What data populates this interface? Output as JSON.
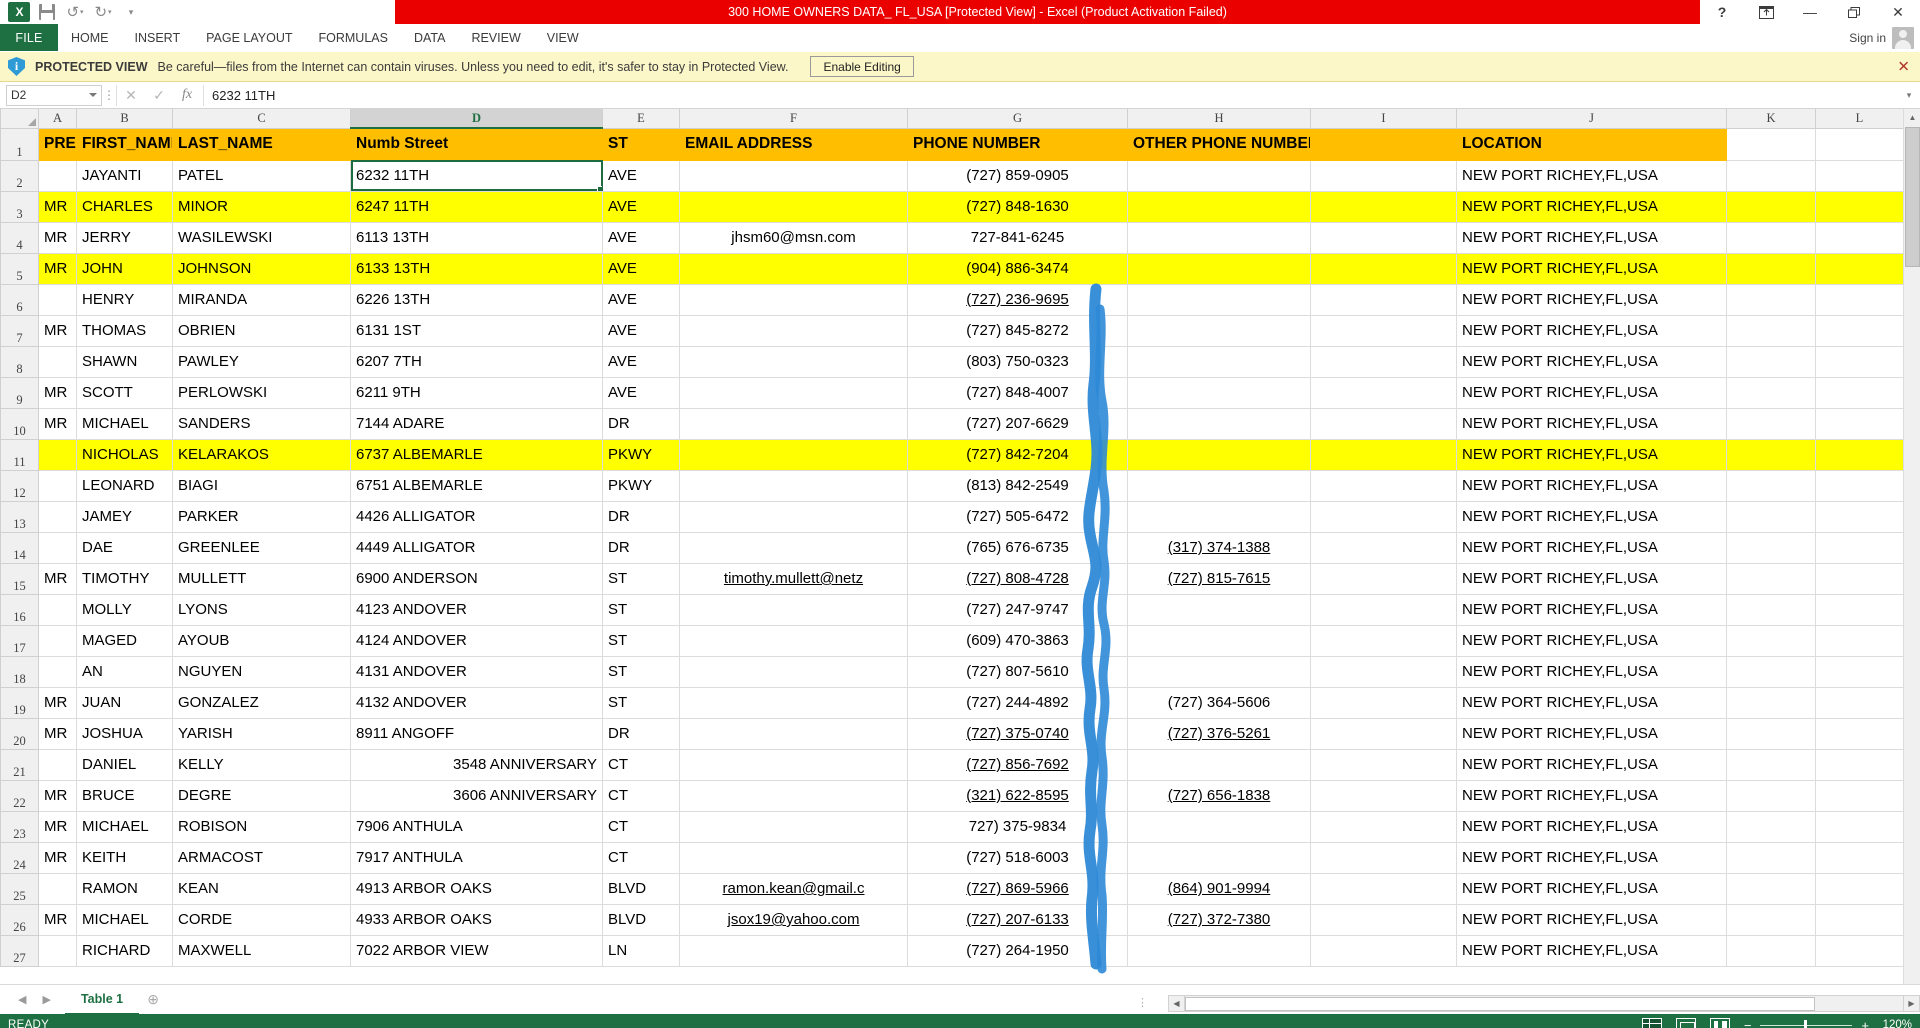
{
  "window": {
    "title": "300 HOME OWNERS DATA_ FL_USA  [Protected View]  -  Excel (Product Activation Failed)",
    "help_icon": "?",
    "ribbon_display_icon": "⇱",
    "minimize_icon": "—",
    "restore_icon": "❐",
    "close_icon": "✕",
    "excel_logo_text": "X",
    "undo_icon": "↺",
    "redo_icon": "↻",
    "qat_more_icon": "▾"
  },
  "ribbon": {
    "file_tab": "FILE",
    "tabs": [
      "HOME",
      "INSERT",
      "PAGE LAYOUT",
      "FORMULAS",
      "DATA",
      "REVIEW",
      "VIEW"
    ],
    "sign_in": "Sign in",
    "avatar_name": "user-avatar"
  },
  "protected_view": {
    "shield_icon": "i",
    "label": "PROTECTED VIEW",
    "message": "Be careful—files from the Internet can contain viruses. Unless you need to edit, it's safer to stay in Protected View.",
    "enable_button": "Enable Editing",
    "close_icon": "✕"
  },
  "formula_bar": {
    "name_box_value": "D2",
    "cancel_icon": "✕",
    "confirm_icon": "✓",
    "function_icon": "fx",
    "formula_value": "6232 11TH",
    "expand_icon": "▾"
  },
  "grid": {
    "selected_cell": "D2",
    "selected_column": "D",
    "column_letters": [
      "A",
      "B",
      "C",
      "D",
      "E",
      "F",
      "G",
      "H",
      "I",
      "J",
      "K",
      "L"
    ],
    "row_numbers": [
      "1",
      "2",
      "3",
      "4",
      "5",
      "6",
      "7",
      "8",
      "9",
      "10",
      "11",
      "12",
      "13",
      "14",
      "15",
      "16",
      "17",
      "18",
      "19",
      "20",
      "21",
      "22",
      "23",
      "24",
      "25",
      "26",
      "27"
    ],
    "headers": {
      "A": "PRE",
      "B": "FIRST_NAME",
      "C": "LAST_NAME",
      "D": "Numb  Street",
      "E": "ST",
      "F": "EMAIL ADDRESS",
      "G": "PHONE NUMBER",
      "H": "OTHER PHONE NUMBER",
      "I": "",
      "J": "LOCATION",
      "K": "",
      "L": ""
    },
    "rows": [
      {
        "n": "2",
        "pre": "",
        "first": "JAYANTI",
        "last": "PATEL",
        "street": "6232 11TH",
        "st": "AVE",
        "email": "",
        "email_link": false,
        "phone": "(727) 859-0905",
        "phone_link": false,
        "other": "",
        "other_link": false,
        "location": "NEW PORT RICHEY,FL,USA",
        "highlight": false,
        "street_align": "left"
      },
      {
        "n": "3",
        "pre": "MR",
        "first": "CHARLES",
        "last": "MINOR",
        "street": "6247 11TH",
        "st": "AVE",
        "email": "",
        "email_link": false,
        "phone": "(727) 848-1630",
        "phone_link": false,
        "other": "",
        "other_link": false,
        "location": "NEW PORT RICHEY,FL,USA",
        "highlight": true,
        "street_align": "left"
      },
      {
        "n": "4",
        "pre": "MR",
        "first": "JERRY",
        "last": "WASILEWSKI",
        "street": "6113 13TH",
        "st": "AVE",
        "email": "jhsm60@msn.com",
        "email_link": false,
        "phone": "727-841-6245",
        "phone_link": false,
        "other": "",
        "other_link": false,
        "location": "NEW PORT RICHEY,FL,USA",
        "highlight": false,
        "street_align": "left"
      },
      {
        "n": "5",
        "pre": "MR",
        "first": "JOHN",
        "last": "JOHNSON",
        "street": "6133 13TH",
        "st": "AVE",
        "email": "",
        "email_link": false,
        "phone": "(904) 886-3474",
        "phone_link": false,
        "other": "",
        "other_link": false,
        "location": "NEW PORT RICHEY,FL,USA",
        "highlight": true,
        "street_align": "left"
      },
      {
        "n": "6",
        "pre": "",
        "first": "HENRY",
        "last": "MIRANDA",
        "street": "6226 13TH",
        "st": "AVE",
        "email": "",
        "email_link": false,
        "phone": "(727) 236-9695",
        "phone_link": true,
        "other": "",
        "other_link": false,
        "location": "NEW PORT RICHEY,FL,USA",
        "highlight": false,
        "street_align": "left"
      },
      {
        "n": "7",
        "pre": "MR",
        "first": "THOMAS",
        "last": "OBRIEN",
        "street": "6131 1ST",
        "st": "AVE",
        "email": "",
        "email_link": false,
        "phone": "(727) 845-8272",
        "phone_link": false,
        "other": "",
        "other_link": false,
        "location": "NEW PORT RICHEY,FL,USA",
        "highlight": false,
        "street_align": "left"
      },
      {
        "n": "8",
        "pre": "",
        "first": "SHAWN",
        "last": "PAWLEY",
        "street": "6207 7TH",
        "st": "AVE",
        "email": "",
        "email_link": false,
        "phone": "(803) 750-0323",
        "phone_link": false,
        "other": "",
        "other_link": false,
        "location": "NEW PORT RICHEY,FL,USA",
        "highlight": false,
        "street_align": "left"
      },
      {
        "n": "9",
        "pre": "MR",
        "first": "SCOTT",
        "last": "PERLOWSKI",
        "street": "6211 9TH",
        "st": "AVE",
        "email": "",
        "email_link": false,
        "phone": "(727) 848-4007",
        "phone_link": false,
        "other": "",
        "other_link": false,
        "location": "NEW PORT RICHEY,FL,USA",
        "highlight": false,
        "street_align": "left"
      },
      {
        "n": "10",
        "pre": "MR",
        "first": "MICHAEL",
        "last": "SANDERS",
        "street": "7144 ADARE",
        "st": "DR",
        "email": "",
        "email_link": false,
        "phone": "(727) 207-6629",
        "phone_link": false,
        "other": "",
        "other_link": false,
        "location": "NEW PORT RICHEY,FL,USA",
        "highlight": false,
        "street_align": "left"
      },
      {
        "n": "11",
        "pre": "",
        "first": "NICHOLAS",
        "last": "KELARAKOS",
        "street": "6737 ALBEMARLE",
        "st": "PKWY",
        "email": "",
        "email_link": false,
        "phone": "(727) 842-7204",
        "phone_link": false,
        "other": "",
        "other_link": false,
        "location": "NEW PORT RICHEY,FL,USA",
        "highlight": true,
        "street_align": "left"
      },
      {
        "n": "12",
        "pre": "",
        "first": "LEONARD",
        "last": "BIAGI",
        "street": "6751 ALBEMARLE",
        "st": "PKWY",
        "email": "",
        "email_link": false,
        "phone": "(813) 842-2549",
        "phone_link": false,
        "other": "",
        "other_link": false,
        "location": "NEW PORT RICHEY,FL,USA",
        "highlight": false,
        "street_align": "left"
      },
      {
        "n": "13",
        "pre": "",
        "first": "JAMEY",
        "last": "PARKER",
        "street": "4426 ALLIGATOR",
        "st": "DR",
        "email": "",
        "email_link": false,
        "phone": "(727) 505-6472",
        "phone_link": false,
        "other": "",
        "other_link": false,
        "location": "NEW PORT RICHEY,FL,USA",
        "highlight": false,
        "street_align": "left"
      },
      {
        "n": "14",
        "pre": "",
        "first": "DAE",
        "last": "GREENLEE",
        "street": "4449 ALLIGATOR",
        "st": "DR",
        "email": "",
        "email_link": false,
        "phone": "(765) 676-6735",
        "phone_link": false,
        "other": "(317) 374-1388",
        "other_link": true,
        "location": "NEW PORT RICHEY,FL,USA",
        "highlight": false,
        "street_align": "left"
      },
      {
        "n": "15",
        "pre": "MR",
        "first": "TIMOTHY",
        "last": "MULLETT",
        "street": "6900 ANDERSON",
        "st": "ST",
        "email": "timothy.mullett@netz",
        "email_link": true,
        "phone": "(727) 808-4728",
        "phone_link": true,
        "other": "(727) 815-7615",
        "other_link": true,
        "location": "NEW PORT RICHEY,FL,USA",
        "highlight": false,
        "street_align": "left"
      },
      {
        "n": "16",
        "pre": "",
        "first": "MOLLY",
        "last": "LYONS",
        "street": "4123 ANDOVER",
        "st": "ST",
        "email": "",
        "email_link": false,
        "phone": "(727) 247-9747",
        "phone_link": false,
        "other": "",
        "other_link": false,
        "location": "NEW PORT RICHEY,FL,USA",
        "highlight": false,
        "street_align": "left"
      },
      {
        "n": "17",
        "pre": "",
        "first": "MAGED",
        "last": "AYOUB",
        "street": "4124 ANDOVER",
        "st": "ST",
        "email": "",
        "email_link": false,
        "phone": "(609) 470-3863",
        "phone_link": false,
        "other": "",
        "other_link": false,
        "location": "NEW PORT RICHEY,FL,USA",
        "highlight": false,
        "street_align": "left"
      },
      {
        "n": "18",
        "pre": "",
        "first": "AN",
        "last": "NGUYEN",
        "street": "4131 ANDOVER",
        "st": "ST",
        "email": "",
        "email_link": false,
        "phone": "(727) 807-5610",
        "phone_link": false,
        "other": "",
        "other_link": false,
        "location": "NEW PORT RICHEY,FL,USA",
        "highlight": false,
        "street_align": "left"
      },
      {
        "n": "19",
        "pre": "MR",
        "first": "JUAN",
        "last": "GONZALEZ",
        "street": "4132 ANDOVER",
        "st": "ST",
        "email": "",
        "email_link": false,
        "phone": "(727) 244-4892",
        "phone_link": false,
        "other": "(727) 364-5606",
        "other_link": false,
        "location": "NEW PORT RICHEY,FL,USA",
        "highlight": false,
        "street_align": "left"
      },
      {
        "n": "20",
        "pre": "MR",
        "first": "JOSHUA",
        "last": "YARISH",
        "street": "8911 ANGOFF",
        "st": "DR",
        "email": "",
        "email_link": false,
        "phone": "(727) 375-0740",
        "phone_link": true,
        "other": "(727) 376-5261",
        "other_link": true,
        "location": "NEW PORT RICHEY,FL,USA",
        "highlight": false,
        "street_align": "left"
      },
      {
        "n": "21",
        "pre": "",
        "first": "DANIEL",
        "last": "KELLY",
        "street": "3548 ANNIVERSARY",
        "st": "CT",
        "email": "",
        "email_link": false,
        "phone": "(727) 856-7692",
        "phone_link": true,
        "other": "",
        "other_link": false,
        "location": "NEW PORT RICHEY,FL,USA",
        "highlight": false,
        "street_align": "right"
      },
      {
        "n": "22",
        "pre": "MR",
        "first": "BRUCE",
        "last": "DEGRE",
        "street": "3606 ANNIVERSARY",
        "st": "CT",
        "email": "",
        "email_link": false,
        "phone": "(321) 622-8595",
        "phone_link": true,
        "other": "(727) 656-1838",
        "other_link": true,
        "location": "NEW PORT RICHEY,FL,USA",
        "highlight": false,
        "street_align": "right"
      },
      {
        "n": "23",
        "pre": "MR",
        "first": "MICHAEL",
        "last": "ROBISON",
        "street": "7906 ANTHULA",
        "st": "CT",
        "email": "",
        "email_link": false,
        "phone": "727) 375-9834",
        "phone_link": false,
        "other": "",
        "other_link": false,
        "location": "NEW PORT RICHEY,FL,USA",
        "highlight": false,
        "street_align": "left"
      },
      {
        "n": "24",
        "pre": "MR",
        "first": "KEITH",
        "last": "ARMACOST",
        "street": "7917 ANTHULA",
        "st": "CT",
        "email": "",
        "email_link": false,
        "phone": "(727) 518-6003",
        "phone_link": false,
        "other": "",
        "other_link": false,
        "location": "NEW PORT RICHEY,FL,USA",
        "highlight": false,
        "street_align": "left"
      },
      {
        "n": "25",
        "pre": "",
        "first": "RAMON",
        "last": "KEAN",
        "street": "4913 ARBOR OAKS",
        "st": "BLVD",
        "email": "ramon.kean@gmail.c",
        "email_link": true,
        "phone": "(727) 869-5966",
        "phone_link": true,
        "other": "(864) 901-9994",
        "other_link": true,
        "location": "NEW PORT RICHEY,FL,USA",
        "highlight": false,
        "street_align": "left"
      },
      {
        "n": "26",
        "pre": "MR",
        "first": "MICHAEL",
        "last": "CORDE",
        "street": "4933 ARBOR OAKS",
        "st": "BLVD",
        "email": "jsox19@yahoo.com",
        "email_link": true,
        "phone": "(727) 207-6133",
        "phone_link": true,
        "other": "(727) 372-7380",
        "other_link": true,
        "location": "NEW PORT RICHEY,FL,USA",
        "highlight": false,
        "street_align": "left"
      },
      {
        "n": "27",
        "pre": "",
        "first": "RICHARD",
        "last": "MAXWELL",
        "street": "7022 ARBOR VIEW",
        "st": "LN",
        "email": "",
        "email_link": false,
        "phone": "(727) 264-1950",
        "phone_link": false,
        "other": "",
        "other_link": false,
        "location": "NEW PORT RICHEY,FL,USA",
        "highlight": false,
        "street_align": "left"
      }
    ]
  },
  "sheet_bar": {
    "prev_icon": "◀",
    "next_icon": "▶",
    "tabs": [
      "Table 1"
    ],
    "add_sheet_icon": "⊕"
  },
  "status_bar": {
    "left_text": "READY",
    "view_normal": "normal-view",
    "view_page_layout": "page-layout-view",
    "view_page_break": "page-break-view",
    "zoom_out_icon": "−",
    "zoom_in_icon": "+",
    "zoom_level": "120%"
  },
  "colors": {
    "title_red": "#eb0000",
    "excel_green": "#1e6f42",
    "header_orange": "#ffbf00",
    "highlight_yellow": "#ffff00",
    "hyperlink_blue": "#0000d4",
    "annotation_blue": "#2e8ad6",
    "protected_view_bg": "#fcf7c8"
  },
  "annotation": {
    "type": "freehand-pen-mark",
    "description": "vertical blue hand-drawn line over PHONE NUMBER column"
  }
}
